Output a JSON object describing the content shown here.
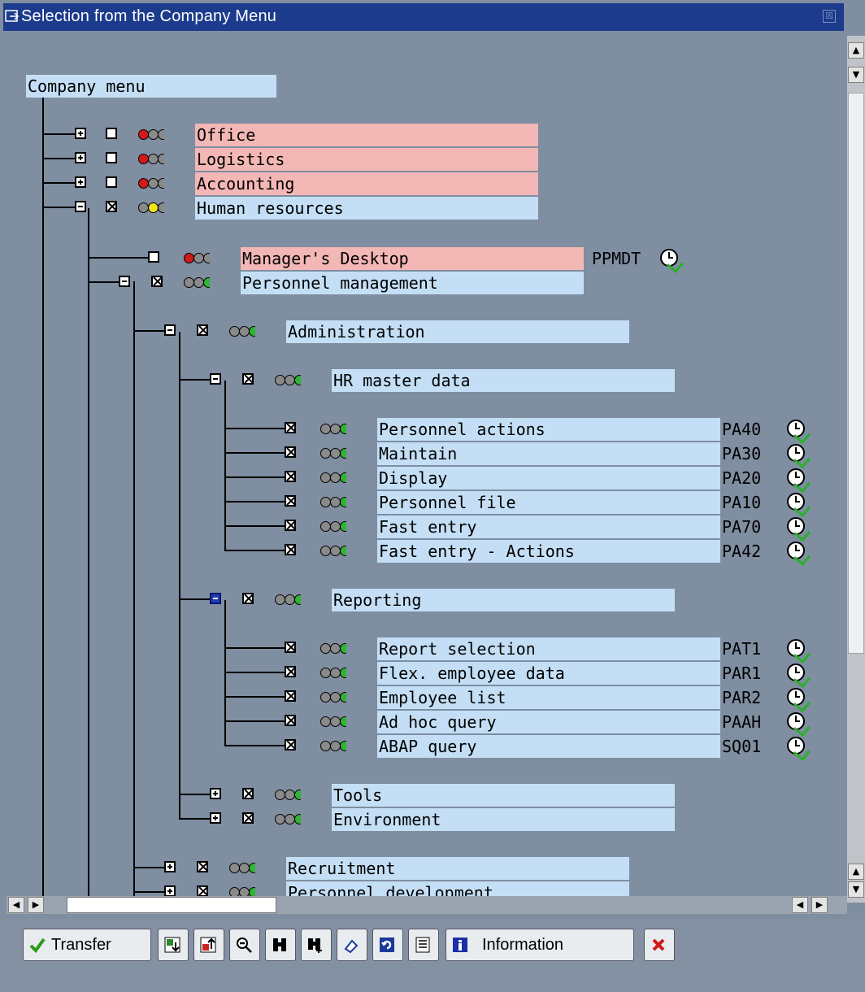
{
  "window": {
    "title": "Selection from the Company Menu",
    "close_label": "☒"
  },
  "tree": {
    "root_label": "Company menu",
    "nodes": [
      {
        "label": "Office",
        "tcode": "",
        "lights": [
          "red",
          "gray",
          "gray"
        ],
        "checked": false,
        "expander": "plus",
        "highlight": "red"
      },
      {
        "label": "Logistics",
        "tcode": "",
        "lights": [
          "red",
          "gray",
          "gray"
        ],
        "checked": false,
        "expander": "plus",
        "highlight": "red"
      },
      {
        "label": "Accounting",
        "tcode": "",
        "lights": [
          "red",
          "gray",
          "gray"
        ],
        "checked": false,
        "expander": "plus",
        "highlight": "red"
      },
      {
        "label": "Human resources",
        "tcode": "",
        "lights": [
          "gray",
          "yellow",
          "gray"
        ],
        "checked": true,
        "expander": "minus",
        "highlight": "blue"
      },
      {
        "label": "Manager's Desktop",
        "tcode": "PPMDT",
        "lights": [
          "red",
          "gray",
          "gray"
        ],
        "checked": false,
        "expander": "none",
        "highlight": "red"
      },
      {
        "label": "Personnel management",
        "tcode": "",
        "lights": [
          "gray",
          "gray",
          "green"
        ],
        "checked": true,
        "expander": "minus",
        "highlight": "blue"
      },
      {
        "label": "Administration",
        "tcode": "",
        "lights": [
          "gray",
          "gray",
          "green"
        ],
        "checked": true,
        "expander": "minus",
        "highlight": "blue"
      },
      {
        "label": "HR master data",
        "tcode": "",
        "lights": [
          "gray",
          "gray",
          "green"
        ],
        "checked": true,
        "expander": "minus",
        "highlight": "blue"
      },
      {
        "label": "Personnel actions",
        "tcode": "PA40",
        "lights": [
          "gray",
          "gray",
          "green"
        ],
        "checked": true,
        "expander": "none",
        "highlight": "blue"
      },
      {
        "label": "Maintain",
        "tcode": "PA30",
        "lights": [
          "gray",
          "gray",
          "green"
        ],
        "checked": true,
        "expander": "none",
        "highlight": "blue"
      },
      {
        "label": "Display",
        "tcode": "PA20",
        "lights": [
          "gray",
          "gray",
          "green"
        ],
        "checked": true,
        "expander": "none",
        "highlight": "blue"
      },
      {
        "label": "Personnel file",
        "tcode": "PA10",
        "lights": [
          "gray",
          "gray",
          "green"
        ],
        "checked": true,
        "expander": "none",
        "highlight": "blue"
      },
      {
        "label": "Fast entry",
        "tcode": "PA70",
        "lights": [
          "gray",
          "gray",
          "green"
        ],
        "checked": true,
        "expander": "none",
        "highlight": "blue"
      },
      {
        "label": "Fast entry - Actions",
        "tcode": "PA42",
        "lights": [
          "gray",
          "gray",
          "green"
        ],
        "checked": true,
        "expander": "none",
        "highlight": "blue"
      },
      {
        "label": "Reporting",
        "tcode": "",
        "lights": [
          "gray",
          "gray",
          "green"
        ],
        "checked": true,
        "expander": "minus-selected",
        "highlight": "blue"
      },
      {
        "label": "Report selection",
        "tcode": "PAT1",
        "lights": [
          "gray",
          "gray",
          "green"
        ],
        "checked": true,
        "expander": "none",
        "highlight": "blue"
      },
      {
        "label": "Flex. employee data",
        "tcode": "PAR1",
        "lights": [
          "gray",
          "gray",
          "green"
        ],
        "checked": true,
        "expander": "none",
        "highlight": "blue"
      },
      {
        "label": "Employee list",
        "tcode": "PAR2",
        "lights": [
          "gray",
          "gray",
          "green"
        ],
        "checked": true,
        "expander": "none",
        "highlight": "blue"
      },
      {
        "label": "Ad hoc query",
        "tcode": "PAAH",
        "lights": [
          "gray",
          "gray",
          "green"
        ],
        "checked": true,
        "expander": "none",
        "highlight": "blue"
      },
      {
        "label": "ABAP query",
        "tcode": "SQ01",
        "lights": [
          "gray",
          "gray",
          "green"
        ],
        "checked": true,
        "expander": "none",
        "highlight": "blue"
      },
      {
        "label": "Tools",
        "tcode": "",
        "lights": [
          "gray",
          "gray",
          "green"
        ],
        "checked": true,
        "expander": "plus",
        "highlight": "blue"
      },
      {
        "label": "Environment",
        "tcode": "",
        "lights": [
          "gray",
          "gray",
          "green"
        ],
        "checked": true,
        "expander": "plus",
        "highlight": "blue"
      },
      {
        "label": "Recruitment",
        "tcode": "",
        "lights": [
          "gray",
          "gray",
          "green"
        ],
        "checked": true,
        "expander": "plus",
        "highlight": "blue"
      },
      {
        "label": "Personnel development",
        "tcode": "",
        "lights": [
          "gray",
          "gray",
          "green"
        ],
        "checked": true,
        "expander": "plus",
        "highlight": "blue"
      }
    ]
  },
  "colors": {
    "red": "#d11a1a",
    "yellow": "#f2e21a",
    "green": "#2fb52f",
    "gray": "#8a8a8a",
    "row_blue": "#c4dff5",
    "row_red": "#f3b7b5"
  },
  "toolbar": {
    "transfer_label": "Transfer",
    "information_label": "Information",
    "icons": [
      "expand-subtree-icon",
      "collapse-subtree-icon",
      "zoom-icon",
      "find-icon",
      "find-next-icon",
      "undo-icon",
      "refresh-icon",
      "legend-icon"
    ]
  }
}
